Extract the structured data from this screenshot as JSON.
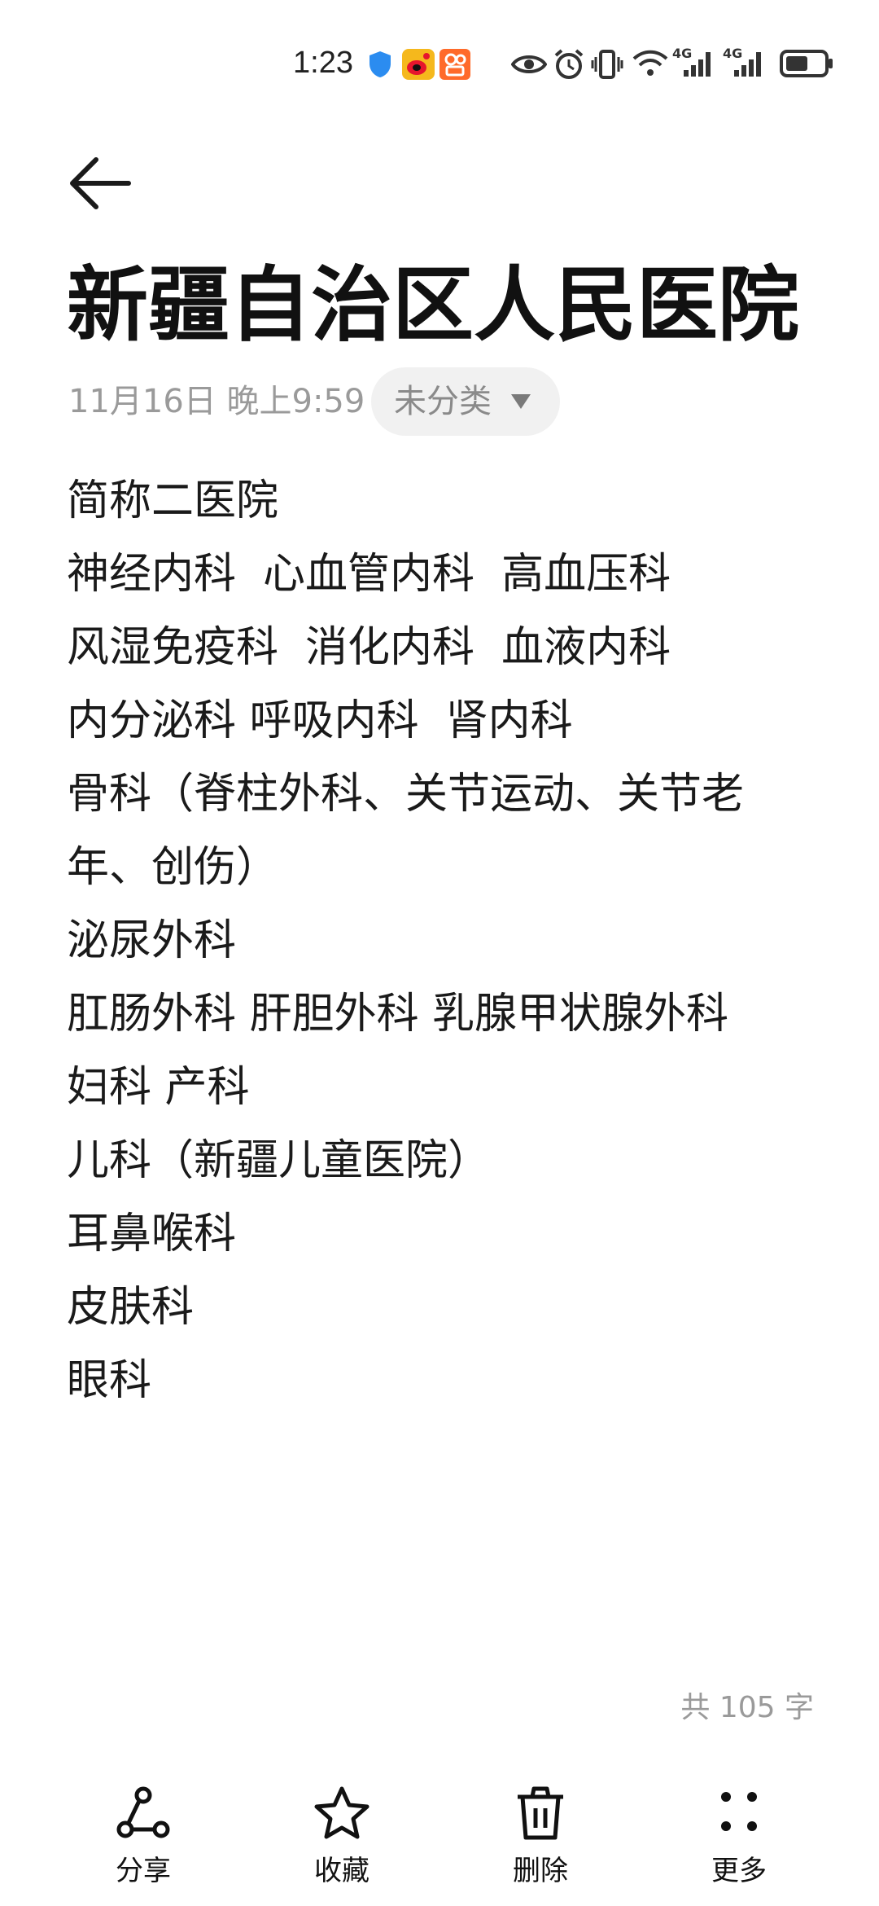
{
  "status_bar": {
    "time": "1:23",
    "network_left": "4G",
    "network_right": "4G"
  },
  "note": {
    "title": "新疆自治区人民医院",
    "date": "11月16日 晚上9:59",
    "category": "未分类",
    "lines": [
      "简称二医院",
      "神经内科  心血管内科  高血压科",
      "风湿免疫科  消化内科  血液内科",
      "内分泌科 呼吸内科  肾内科",
      "骨科（脊柱外科、关节运动、关节老",
      "年、创伤）",
      "泌尿外科",
      "肛肠外科 肝胆外科 乳腺甲状腺外科",
      "妇科 产科",
      "儿科（新疆儿童医院）",
      "耳鼻喉科",
      "皮肤科",
      "眼科"
    ],
    "word_count": "共 105 字"
  },
  "toolbar": {
    "share_label": "分享",
    "favorite_label": "收藏",
    "delete_label": "删除",
    "more_label": "更多"
  },
  "icons": {
    "back": "back-arrow-icon",
    "share": "share-icon",
    "favorite": "star-icon",
    "delete": "trash-icon",
    "more": "more-dots-icon",
    "dropdown": "chevron-down-icon"
  }
}
